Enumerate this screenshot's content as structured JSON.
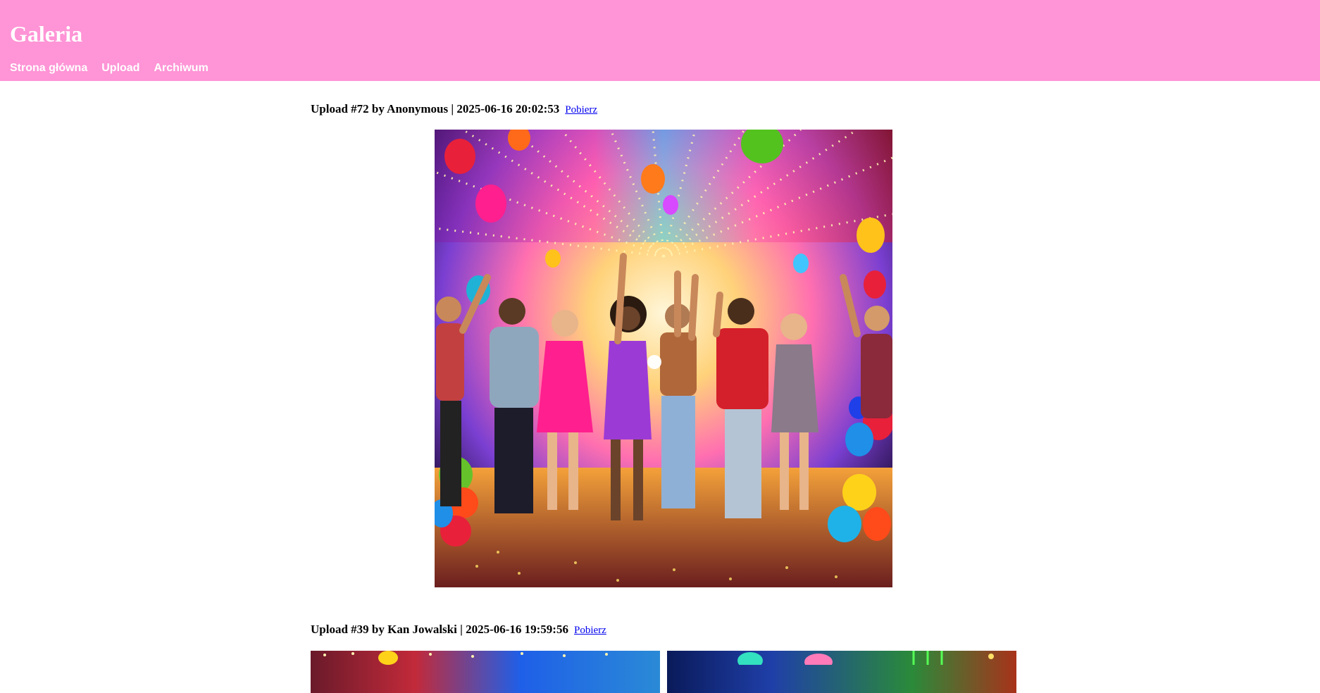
{
  "site": {
    "title": "Galeria",
    "header_color": "#ff94d6"
  },
  "nav": {
    "items": [
      {
        "label": "Strona główna"
      },
      {
        "label": "Upload"
      },
      {
        "label": "Archiwum"
      }
    ]
  },
  "posts": [
    {
      "header": "Upload #72 by Anonymous | 2025-06-16 20:02:53",
      "download_label": "Pobierz",
      "image_alt": "party-dancing-image"
    },
    {
      "header": "Upload #39 by Kan Jowalski | 2025-06-16 19:59:56",
      "download_label": "Pobierz"
    }
  ]
}
